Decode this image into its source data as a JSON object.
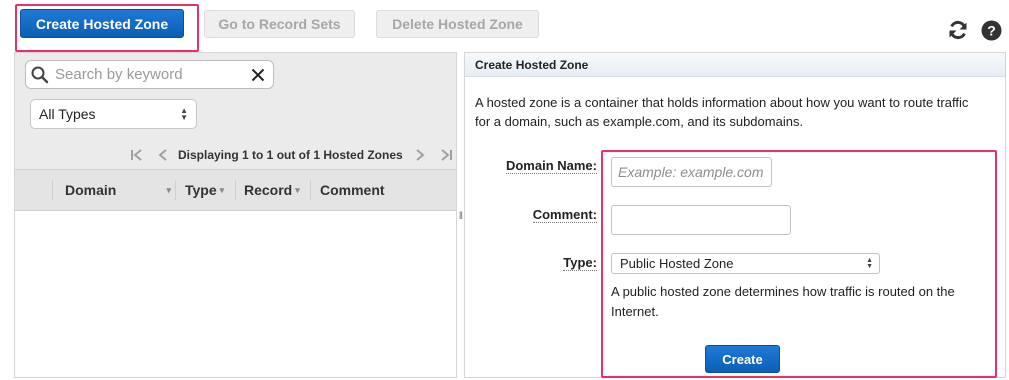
{
  "toolbar": {
    "create_label": "Create Hosted Zone",
    "record_sets_label": "Go to Record Sets",
    "delete_label": "Delete Hosted Zone"
  },
  "left": {
    "search": {
      "placeholder": "Search by keyword",
      "value": ""
    },
    "type_filter": {
      "selected": "All Types"
    },
    "pager_text": "Displaying 1 to 1 out of 1 Hosted Zones",
    "columns": [
      "Domain",
      "Type",
      "Record",
      "Comment"
    ]
  },
  "right": {
    "header": "Create Hosted Zone",
    "description": "A hosted zone is a container that holds information about how you want to route traffic for a domain, such as example.com, and its subdomains.",
    "form": {
      "domain_label": "Domain Name:",
      "domain_placeholder": "Example: example.com",
      "comment_label": "Comment:",
      "type_label": "Type:",
      "type_selected": "Public Hosted Zone",
      "type_description": "A public hosted zone determines how traffic is routed on the Internet.",
      "create_label": "Create"
    }
  },
  "colors": {
    "primary": "#0c5fb5",
    "highlight": "#e8316b",
    "panel_header": "#e7edf5"
  },
  "icons": [
    "refresh-icon",
    "help-icon",
    "search-icon",
    "clear-icon",
    "first-page-icon",
    "prev-page-icon",
    "next-page-icon",
    "last-page-icon"
  ]
}
